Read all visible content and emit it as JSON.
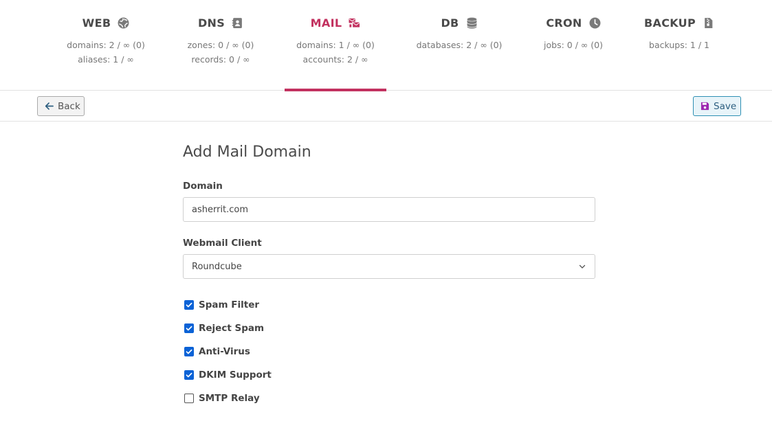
{
  "nav": {
    "tabs": [
      {
        "name": "WEB",
        "icon": "globe-icon",
        "stats": [
          "domains: 2 / ∞ (0)",
          "aliases: 1 / ∞"
        ]
      },
      {
        "name": "DNS",
        "icon": "address-book-icon",
        "stats": [
          "zones: 0 / ∞ (0)",
          "records: 0 / ∞"
        ]
      },
      {
        "name": "MAIL",
        "icon": "mail-bulk-icon",
        "stats": [
          "domains: 1 / ∞ (0)",
          "accounts: 2 / ∞"
        ]
      },
      {
        "name": "DB",
        "icon": "database-icon",
        "stats": [
          "databases: 2 / ∞ (0)"
        ]
      },
      {
        "name": "CRON",
        "icon": "clock-icon",
        "stats": [
          "jobs: 0 / ∞ (0)"
        ]
      },
      {
        "name": "BACKUP",
        "icon": "file-archive-icon",
        "stats": [
          "backups: 1 / 1"
        ]
      }
    ],
    "active_tab": "MAIL"
  },
  "toolbar": {
    "back_label": "Back",
    "save_label": "Save"
  },
  "form": {
    "title": "Add Mail Domain",
    "domain_label": "Domain",
    "domain_value": "asherrit.com",
    "webmail_label": "Webmail Client",
    "webmail_value": "Roundcube",
    "options": [
      {
        "label": "Spam Filter",
        "checked": true
      },
      {
        "label": "Reject Spam",
        "checked": true
      },
      {
        "label": "Anti-Virus",
        "checked": true
      },
      {
        "label": "DKIM Support",
        "checked": true
      },
      {
        "label": "SMTP Relay",
        "checked": false
      }
    ]
  },
  "colors": {
    "accent": "#c2315f",
    "checkbox": "#0b62d6",
    "save_border": "#2d8fb3"
  }
}
